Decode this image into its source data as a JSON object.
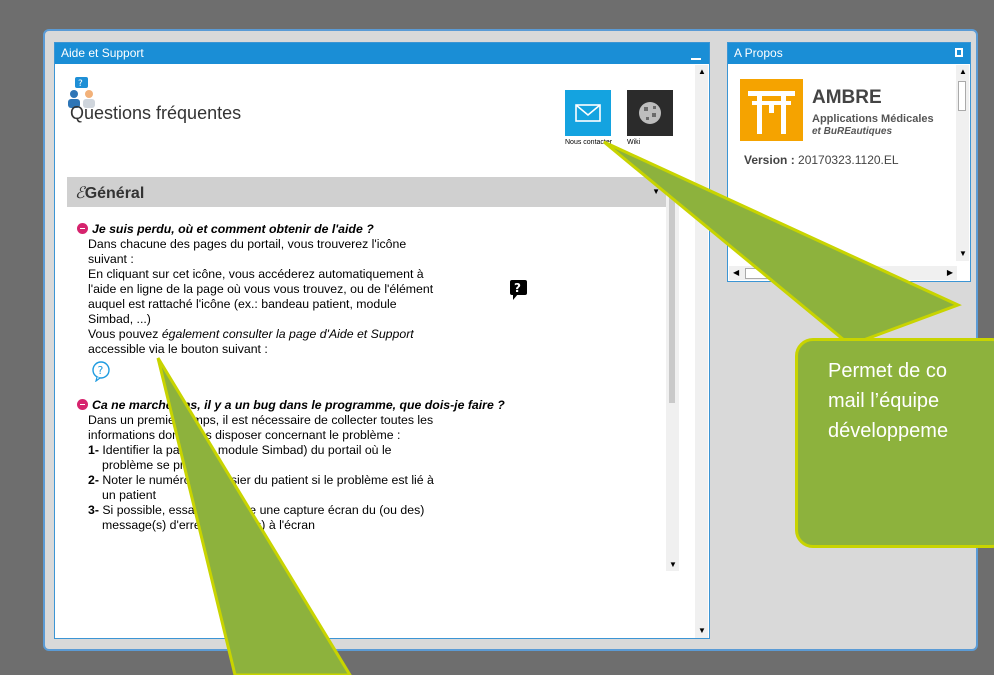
{
  "help_panel": {
    "title": "Aide et Support",
    "heading": "Questions fréquentes",
    "contact_label": "Nous contacter",
    "wiki_label": "Wiki",
    "category": "Général",
    "q1": {
      "question": "Je suis perdu, où et comment obtenir de l'aide ?",
      "lines": [
        "Dans chacune des pages du portail, vous trouverez l'icône",
        "suivant :",
        "En cliquant sur cet icône, vous accéderez automatiquement à",
        "l'aide en ligne de la page où vous vous trouvez, ou de l'élément",
        "auquel est rattaché l'icône (ex.: bandeau patient, module",
        "Simbad, ...)"
      ],
      "line7a": "Vous pouvez ",
      "line7b": "également consulter la page d'Aide et Support",
      "line8": "accessible via le bouton suivant :"
    },
    "q2": {
      "question": "Ca ne marche pas, il y a un bug dans le programme, que dois-je faire ?",
      "intro1": "Dans un premier temps, il est nécessaire de collecter toutes les",
      "intro2": "informations dont vous disposer concernant le problème :",
      "steps": [
        {
          "n": "1-",
          "a": "Identifier la page (ou module Simbad) du portail où le",
          "b": "problème se produit"
        },
        {
          "n": "2-",
          "a": "Noter le numéro de dossier du patient si le problème est lié à",
          "b": "un patient"
        },
        {
          "n": "3-",
          "a": "Si possible, essayer de faire une capture écran du (ou des)",
          "b": "message(s) d'erreur affiché(s) à l'écran"
        }
      ]
    }
  },
  "about_panel": {
    "title": "A Propos",
    "app_name": "AMBRE",
    "app_sub1": "Applications Médicales",
    "app_sub2": "et BuREautiques",
    "version_label": "Version :",
    "version_value": "20170323.1120.EL"
  },
  "callout": {
    "line1": "Permet de co",
    "line2": "mail l’équipe",
    "line3": "développeme"
  },
  "colors": {
    "titlebar": "#1a8ed6",
    "accent": "#d6236d",
    "callout": "#8db23d"
  }
}
